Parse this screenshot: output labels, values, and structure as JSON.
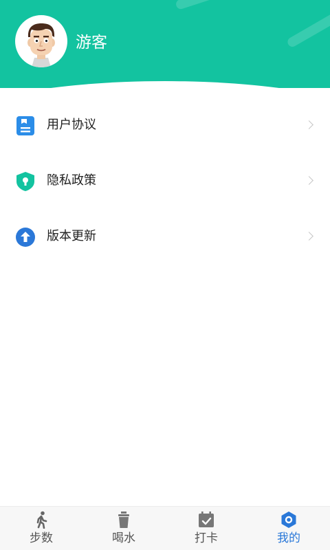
{
  "profile": {
    "username": "游客"
  },
  "menu": {
    "items": [
      {
        "label": "用户协议",
        "icon": "user-agreement-icon",
        "color": "#2b8de8"
      },
      {
        "label": "隐私政策",
        "icon": "privacy-shield-icon",
        "color": "#13c3a0"
      },
      {
        "label": "版本更新",
        "icon": "update-arrow-icon",
        "color": "#2b78d8"
      }
    ]
  },
  "tabbar": {
    "tabs": [
      {
        "label": "步数",
        "icon": "walking-icon"
      },
      {
        "label": "喝水",
        "icon": "cup-icon"
      },
      {
        "label": "打卡",
        "icon": "calendar-check-icon"
      },
      {
        "label": "我的",
        "icon": "profile-hexagon-icon",
        "active": true
      }
    ]
  },
  "colors": {
    "brand": "#13c3a0",
    "active_tab": "#2a78d8"
  }
}
